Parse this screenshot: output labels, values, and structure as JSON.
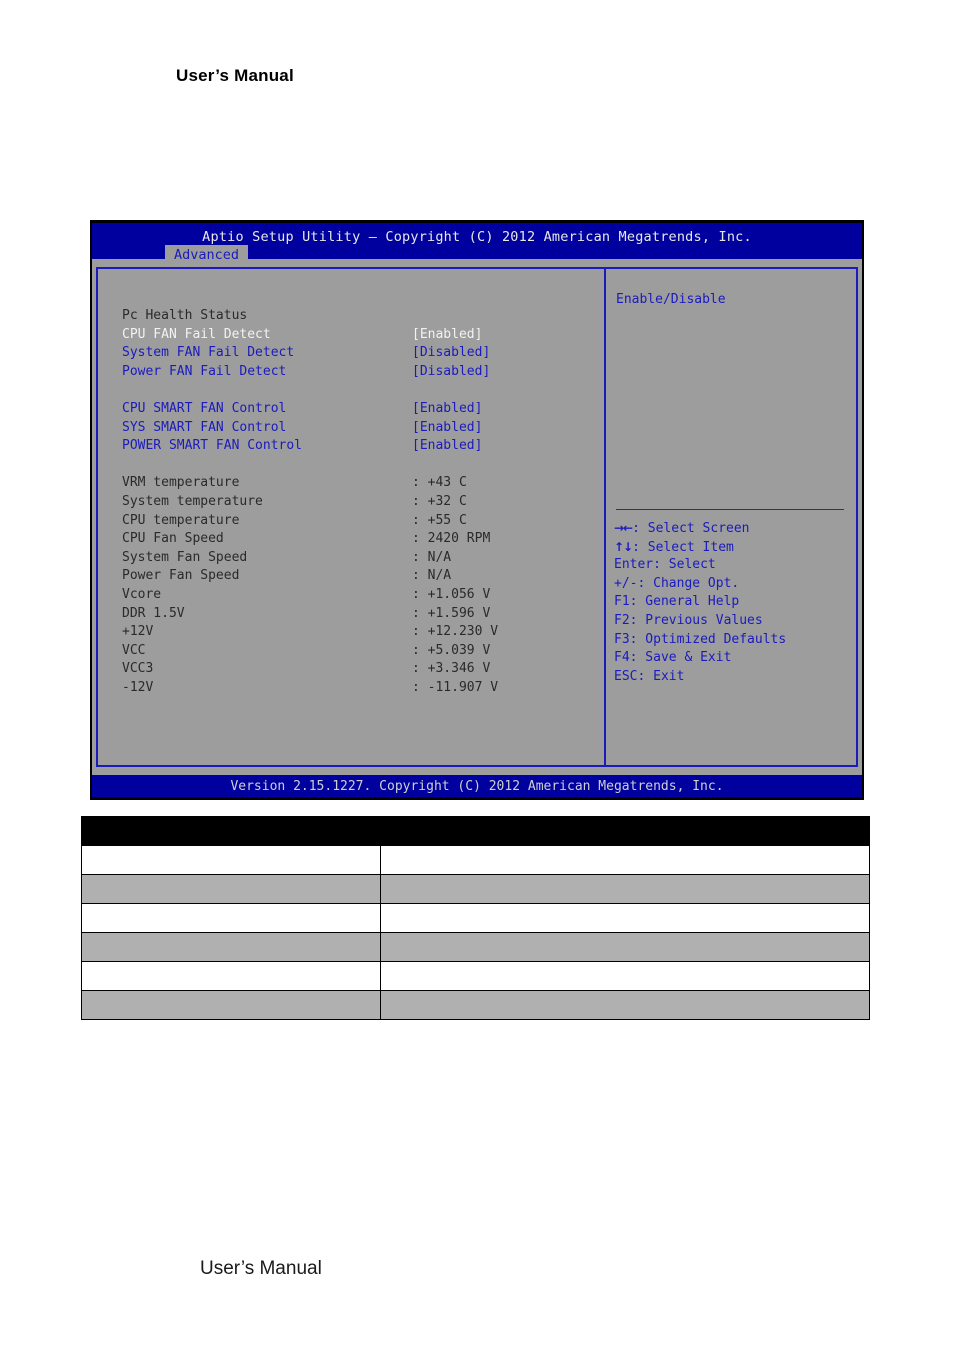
{
  "page": {
    "header_label": "User’s Manual",
    "footer_label": "User’s Manual"
  },
  "bios": {
    "title": "Aptio Setup Utility – Copyright (C) 2012 American Megatrends, Inc.",
    "version_bar": "Version 2.15.1227. Copyright (C) 2012 American Megatrends, Inc.",
    "tabs": [
      {
        "label": "Advanced",
        "active": true
      }
    ],
    "colors": {
      "titlebar_blue": "#00009e",
      "panel_gray": "#9d9d9d",
      "border_blue": "#1b1bbd",
      "text_blue": "#1b1bbd",
      "selected_text": "#f2f2f2",
      "static_text": "#2a2a2a"
    },
    "section_title": "Pc Health Status",
    "settings": [
      {
        "label": "CPU FAN Fail Detect",
        "value": "[Enabled]",
        "selected": true
      },
      {
        "label": "System FAN Fail Detect",
        "value": "[Disabled]",
        "selected": false
      },
      {
        "label": "Power FAN Fail Detect",
        "value": "[Disabled]",
        "selected": false
      },
      {
        "label": "CPU SMART FAN Control",
        "value": "[Enabled]",
        "selected": false
      },
      {
        "label": "SYS SMART FAN Control",
        "value": "[Enabled]",
        "selected": false
      },
      {
        "label": "POWER SMART FAN Control",
        "value": "[Enabled]",
        "selected": false
      }
    ],
    "readings": [
      {
        "label": "VRM temperature",
        "value": ": +43 C"
      },
      {
        "label": "System temperature",
        "value": ": +32 C"
      },
      {
        "label": "CPU temperature",
        "value": ": +55 C"
      },
      {
        "label": "CPU Fan Speed",
        "value": ": 2420 RPM"
      },
      {
        "label": "System Fan Speed",
        "value": ": N/A"
      },
      {
        "label": "Power Fan Speed",
        "value": ": N/A"
      },
      {
        "label": "Vcore",
        "value": ": +1.056 V"
      },
      {
        "label": "DDR 1.5V",
        "value": ": +1.596 V"
      },
      {
        "label": "+12V",
        "value": ": +12.230 V"
      },
      {
        "label": "VCC",
        "value": ": +5.039 V"
      },
      {
        "label": "VCC3",
        "value": ": +3.346 V"
      },
      {
        "label": "-12V",
        "value": ": -11.907 V"
      }
    ],
    "help": {
      "description": "Enable/Disable",
      "keys": [
        {
          "glyph": "→←",
          "text": ": Select Screen"
        },
        {
          "glyph": "↑↓",
          "text": ": Select Item"
        },
        {
          "glyph": "",
          "text": "Enter: Select"
        },
        {
          "glyph": "",
          "text": "+/-: Change Opt."
        },
        {
          "glyph": "",
          "text": "F1: General Help"
        },
        {
          "glyph": "",
          "text": "F2: Previous Values"
        },
        {
          "glyph": "",
          "text": "F3: Optimized Defaults"
        },
        {
          "glyph": "",
          "text": "F4: Save & Exit"
        },
        {
          "glyph": "",
          "text": "ESC: Exit"
        }
      ]
    }
  },
  "table": {
    "headers": [
      "",
      ""
    ],
    "rows": [
      [
        "",
        ""
      ],
      [
        "",
        ""
      ],
      [
        "",
        ""
      ],
      [
        "",
        ""
      ],
      [
        "",
        ""
      ],
      [
        "",
        ""
      ]
    ]
  }
}
